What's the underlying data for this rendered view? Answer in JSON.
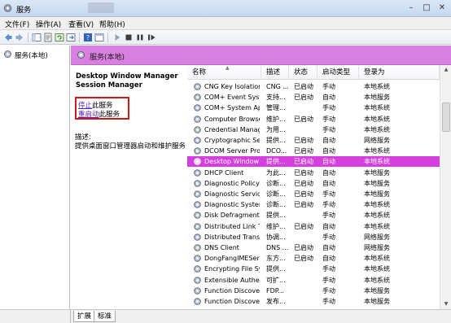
{
  "window": {
    "title": "服务"
  },
  "menu": [
    "文件(F)",
    "操作(A)",
    "查看(V)",
    "帮助(H)"
  ],
  "tree": {
    "item": "服务(本地)"
  },
  "header": {
    "title": "服务(本地)"
  },
  "detail": {
    "service_name": "Desktop Window Manager Session Manager",
    "stop_link": "停止",
    "stop_suffix": "此服务",
    "restart_link": "重启动",
    "restart_suffix": "此服务",
    "description_label": "描述:",
    "description": "提供桌面窗口管理器启动和维护服务"
  },
  "columns": [
    "名称",
    "描述",
    "状态",
    "启动类型",
    "登录为"
  ],
  "rows": [
    {
      "name": "CNG Key Isolation",
      "desc": "CNG ...",
      "status": "已启动",
      "startup": "手动",
      "logon": "本地系统"
    },
    {
      "name": "COM+ Event Syst...",
      "desc": "支持...",
      "status": "已启动",
      "startup": "自动",
      "logon": "本地服务"
    },
    {
      "name": "COM+ System Ap...",
      "desc": "管理...",
      "status": "",
      "startup": "手动",
      "logon": "本地系统"
    },
    {
      "name": "Computer Browser",
      "desc": "维护...",
      "status": "已启动",
      "startup": "手动",
      "logon": "本地系统"
    },
    {
      "name": "Credential Manager",
      "desc": "为用...",
      "status": "",
      "startup": "手动",
      "logon": "本地系统"
    },
    {
      "name": "Cryptographic Ser...",
      "desc": "提供...",
      "status": "已启动",
      "startup": "自动",
      "logon": "网络服务"
    },
    {
      "name": "DCOM Server Pro...",
      "desc": "DCO...",
      "status": "已启动",
      "startup": "自动",
      "logon": "本地系统"
    },
    {
      "name": "Desktop Window ...",
      "desc": "提供...",
      "status": "已启动",
      "startup": "自动",
      "logon": "本地系统",
      "selected": true
    },
    {
      "name": "DHCP Client",
      "desc": "为此...",
      "status": "已启动",
      "startup": "自动",
      "logon": "本地服务"
    },
    {
      "name": "Diagnostic Policy ...",
      "desc": "诊断...",
      "status": "已启动",
      "startup": "自动",
      "logon": "本地服务"
    },
    {
      "name": "Diagnostic Service...",
      "desc": "诊断...",
      "status": "已启动",
      "startup": "手动",
      "logon": "本地服务"
    },
    {
      "name": "Diagnostic System...",
      "desc": "诊断...",
      "status": "已启动",
      "startup": "手动",
      "logon": "本地系统"
    },
    {
      "name": "Disk Defragmenter",
      "desc": "提供...",
      "status": "",
      "startup": "手动",
      "logon": "本地系统"
    },
    {
      "name": "Distributed Link Tr...",
      "desc": "维护...",
      "status": "已启动",
      "startup": "自动",
      "logon": "本地系统"
    },
    {
      "name": "Distributed Transa...",
      "desc": "协调...",
      "status": "",
      "startup": "手动",
      "logon": "网络服务"
    },
    {
      "name": "DNS Client",
      "desc": "DNS ...",
      "status": "已启动",
      "startup": "自动",
      "logon": "网络服务"
    },
    {
      "name": "DongFangIMEServ...",
      "desc": "东方...",
      "status": "已启动",
      "startup": "自动",
      "logon": "本地系统"
    },
    {
      "name": "Encrypting File Sy...",
      "desc": "提供...",
      "status": "",
      "startup": "手动",
      "logon": "本地系统"
    },
    {
      "name": "Extensible Authen...",
      "desc": "可扩...",
      "status": "",
      "startup": "手动",
      "logon": "本地系统"
    },
    {
      "name": "Function Discover...",
      "desc": "FDP...",
      "status": "",
      "startup": "手动",
      "logon": "本地服务"
    },
    {
      "name": "Function Discover...",
      "desc": "发布...",
      "status": "",
      "startup": "手动",
      "logon": "本地服务"
    }
  ],
  "tabs": [
    "扩展",
    "标准"
  ]
}
